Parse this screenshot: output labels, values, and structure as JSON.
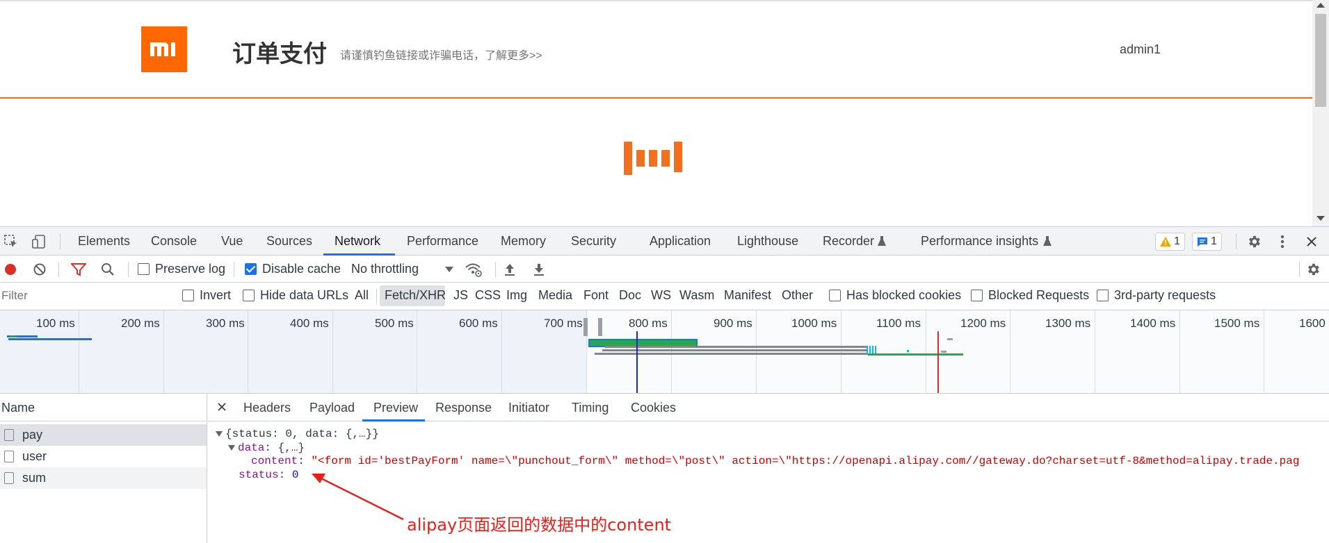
{
  "site": {
    "logo_text": "mi",
    "title": "订单支付",
    "tip": "请谨慎钓鱼链接或诈骗电话，了解更多>>",
    "username": "admin1"
  },
  "devtools": {
    "tabs": [
      "Elements",
      "Console",
      "Vue",
      "Sources",
      "Network",
      "Performance",
      "Memory",
      "Security",
      "Application",
      "Lighthouse",
      "Recorder",
      "Performance insights"
    ],
    "active_tab": "Network",
    "warnings_count": "1",
    "messages_count": "1",
    "toolbar": {
      "preserve_log": "Preserve log",
      "disable_cache": "Disable cache",
      "throttling": "No throttling"
    },
    "filterbar": {
      "placeholder": "Filter",
      "invert": "Invert",
      "hide_data_urls": "Hide data URLs",
      "types": [
        "All",
        "Fetch/XHR",
        "JS",
        "CSS",
        "Img",
        "Media",
        "Font",
        "Doc",
        "WS",
        "Wasm",
        "Manifest",
        "Other"
      ],
      "active_type": "Fetch/XHR",
      "blocked_cookies": "Has blocked cookies",
      "blocked_requests": "Blocked Requests",
      "third_party": "3rd-party requests"
    },
    "timeline_ticks": [
      "100 ms",
      "200 ms",
      "300 ms",
      "400 ms",
      "500 ms",
      "600 ms",
      "700 ms",
      "800 ms",
      "900 ms",
      "1000 ms",
      "1100 ms",
      "1200 ms",
      "1300 ms",
      "1400 ms",
      "1500 ms",
      "1600"
    ],
    "requests": {
      "header": "Name",
      "items": [
        "pay",
        "user",
        "sum"
      ],
      "selected": "pay"
    },
    "detail_tabs": [
      "Headers",
      "Payload",
      "Preview",
      "Response",
      "Initiator",
      "Timing",
      "Cookies"
    ],
    "active_detail_tab": "Preview",
    "preview": {
      "root": "{status: 0, data: {,…}}",
      "data_key": "data",
      "data_summary": "{,…}",
      "content_key": "content",
      "content_value": "\"<form id='bestPayForm' name=\\\"punchout_form\\\" method=\\\"post\\\" action=\\\"https://openapi.alipay.com//gateway.do?charset=utf-8&method=alipay.trade.pag",
      "status_key": "status",
      "status_value": "0"
    }
  },
  "annotation": "alipay页面返回的数据中的content",
  "colors": {
    "brand": "#ff6700",
    "devtools_accent": "#1a73e8",
    "annotation": "#e8201a"
  }
}
